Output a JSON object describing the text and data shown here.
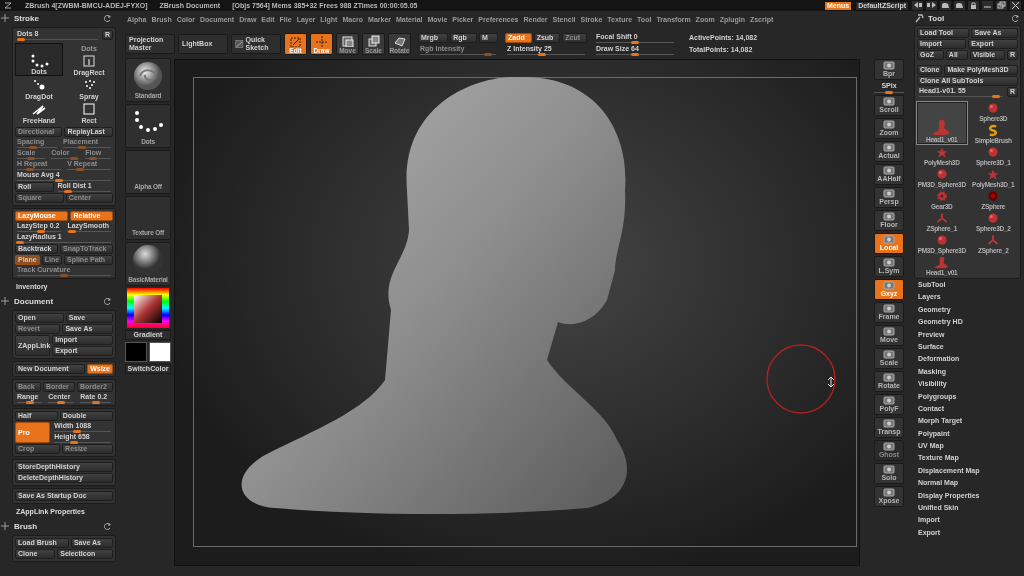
{
  "title_bar": {
    "app": "ZBrush 4[ZWBM-BMCU-ADEJ-FYXO]",
    "document": "ZBrush Document",
    "stats": "[Objs 7564] Mems 385+32 Frees 988 ZTimes 00:00:05.05",
    "menus": {
      "label": "Menus",
      "on": true
    },
    "script": "DefaultZScript"
  },
  "menu_bar": [
    "Alpha",
    "Brush",
    "Color",
    "Document",
    "Draw",
    "Edit",
    "File",
    "Layer",
    "Light",
    "Macro",
    "Marker",
    "Material",
    "Movie",
    "Picker",
    "Preferences",
    "Render",
    "Stencil",
    "Stroke",
    "Texture",
    "Tool",
    "Transform",
    "Zoom",
    "Zplugin",
    "Zscript"
  ],
  "toolbar": {
    "buttons": [
      {
        "kind": "button",
        "label": "Projection Master"
      },
      {
        "kind": "button",
        "label": "LightBox"
      },
      {
        "kind": "icon-button",
        "label": "Quick Sketch"
      }
    ],
    "modes": [
      {
        "label": "Edit",
        "on": true
      },
      {
        "label": "Draw",
        "on": true
      },
      {
        "label": "Move",
        "on": false
      },
      {
        "label": "Scale",
        "on": false
      },
      {
        "label": "Rotate",
        "on": false
      }
    ],
    "groups": [
      {
        "top": [
          {
            "kind": "button",
            "label": "Mrgb",
            "on": false,
            "disabled": false
          },
          {
            "kind": "button",
            "label": "Rgb",
            "on": false,
            "disabled": false
          },
          {
            "kind": "button",
            "label": "M",
            "on": false,
            "disabled": false
          }
        ],
        "bottom": [
          {
            "kind": "slider",
            "label": "Rgb Intensity",
            "level": 0.9,
            "disabled": true
          }
        ]
      },
      {
        "top": [
          {
            "kind": "button",
            "label": "Zadd",
            "on": true,
            "disabled": false
          },
          {
            "kind": "button",
            "label": "Zsub",
            "on": false,
            "disabled": false
          },
          {
            "kind": "button",
            "label": "Zcut",
            "on": false,
            "disabled": true
          }
        ],
        "bottom": [
          {
            "kind": "slider",
            "label": "Z Intensity 25",
            "level": 0.45,
            "disabled": false
          }
        ]
      },
      {
        "top": [
          {
            "kind": "slider",
            "label": "Focal Shift 0",
            "level": 0.5,
            "disabled": false
          }
        ],
        "bottom": [
          {
            "kind": "slider",
            "label": "Draw Size 64",
            "level": 0.5,
            "disabled": false
          }
        ]
      },
      {
        "top": [
          {
            "kind": "text",
            "label": "ActivePoints: 14,082"
          }
        ],
        "bottom": [
          {
            "kind": "text",
            "label": "TotalPoints: 14,082"
          }
        ]
      }
    ]
  },
  "left_panel": [
    {
      "kind": "header",
      "title": "Stroke"
    },
    {
      "kind": "box",
      "rows": [
        [
          {
            "kind": "slider",
            "label": "Dots 8",
            "level": 0.05,
            "disabled": false
          },
          {
            "kind": "small-button",
            "label": "R",
            "on": false,
            "disabled": false
          }
        ]
      ],
      "strokes": [
        {
          "label": "Dots",
          "selected": false
        },
        {
          "label": "Dots",
          "selected": true
        },
        {
          "label": "DragRect",
          "selected": false
        },
        {
          "label": "DragDot",
          "selected": false
        },
        {
          "label": "Spray",
          "selected": false
        },
        {
          "label": "FreeHand",
          "selected": false
        },
        {
          "label": "Rect",
          "selected": false
        }
      ],
      "rows2": [
        [
          {
            "kind": "button",
            "label": "Directional",
            "on": false,
            "disabled": true
          },
          {
            "kind": "button",
            "label": "ReplayLast",
            "on": false,
            "disabled": false
          }
        ],
        [
          {
            "kind": "slider",
            "label": "Spacing",
            "level": 0.4,
            "disabled": true
          },
          {
            "kind": "slider",
            "label": "Placement",
            "level": 0.4,
            "disabled": true
          }
        ],
        [
          {
            "kind": "slider",
            "label": "Scale",
            "level": 0.5,
            "disabled": true
          },
          {
            "kind": "slider",
            "label": "Color",
            "level": 0.8,
            "disabled": true
          },
          {
            "kind": "slider",
            "label": "Flow",
            "level": 0.3,
            "disabled": true
          }
        ],
        [
          {
            "kind": "slider",
            "label": "H Repeat",
            "level": 0.3,
            "disabled": true
          },
          {
            "kind": "slider",
            "label": "V Repeat",
            "level": 0.3,
            "disabled": true
          }
        ],
        [
          {
            "kind": "slider",
            "label": "Mouse Avg 4",
            "level": 0.45,
            "disabled": false
          }
        ],
        [
          {
            "kind": "button",
            "label": "Roll",
            "on": false,
            "disabled": false
          },
          {
            "kind": "slider",
            "label": "Roll Dist 1",
            "level": 0.2,
            "disabled": false
          }
        ],
        [
          {
            "kind": "button",
            "label": "Square",
            "on": false,
            "disabled": true
          },
          {
            "kind": "button",
            "label": "Center",
            "on": false,
            "disabled": true
          }
        ]
      ]
    },
    {
      "kind": "box",
      "rows": [
        [
          {
            "kind": "button",
            "label": "LazyMouse",
            "on": true,
            "disabled": false
          },
          {
            "kind": "button",
            "label": "Relative",
            "on": true,
            "disabled": false
          }
        ],
        [
          {
            "kind": "slider",
            "label": "LazyStep 0.2",
            "level": 0.55,
            "disabled": false
          },
          {
            "kind": "slider",
            "label": "LazySmooth",
            "level": 0.1,
            "disabled": false
          }
        ],
        [
          {
            "kind": "slider",
            "label": "LazyRadius 1",
            "level": 0.03,
            "disabled": false
          }
        ],
        [
          {
            "kind": "button",
            "label": "Backtrack",
            "on": false,
            "disabled": false
          },
          {
            "kind": "button",
            "label": "SnapToTrack",
            "on": false,
            "disabled": true
          }
        ],
        [
          {
            "kind": "pair",
            "items": [
              {
                "kind": "button",
                "label": "Plane",
                "on": true,
                "disabled": true
              },
              {
                "kind": "button",
                "label": "Line",
                "on": false,
                "disabled": true
              }
            ]
          },
          {
            "kind": "button",
            "label": "Spline Path",
            "on": false,
            "disabled": true
          }
        ],
        [
          {
            "kind": "slider",
            "label": "Track Curvature",
            "level": 0.5,
            "disabled": true
          }
        ]
      ]
    },
    {
      "kind": "link",
      "label": "Inventory"
    },
    {
      "kind": "header",
      "title": "Document"
    },
    {
      "kind": "box",
      "rows": [
        [
          {
            "kind": "button",
            "label": "Open",
            "on": false,
            "disabled": false
          },
          {
            "kind": "button",
            "label": "Save",
            "on": false,
            "disabled": false
          }
        ],
        [
          {
            "kind": "button",
            "label": "Revert",
            "on": false,
            "disabled": true
          },
          {
            "kind": "button",
            "label": "Save As",
            "on": false,
            "disabled": false
          }
        ],
        [
          {
            "kind": "tall-button",
            "label": "ZAppLink",
            "on": false,
            "disabled": false
          },
          {
            "kind": "stack",
            "items": [
              {
                "kind": "button",
                "label": "Import",
                "on": false,
                "disabled": false
              },
              {
                "kind": "button",
                "label": "Export",
                "on": false,
                "disabled": false
              }
            ]
          }
        ]
      ]
    },
    {
      "kind": "box",
      "rows": [
        [
          {
            "kind": "button",
            "label": "New Document",
            "on": false,
            "disabled": false
          },
          {
            "kind": "small-button",
            "label": "Wsize",
            "on": true,
            "disabled": false
          }
        ]
      ]
    },
    {
      "kind": "box",
      "rows": [
        [
          {
            "kind": "button",
            "label": "Back",
            "on": false,
            "disabled": true
          },
          {
            "kind": "button",
            "label": "Border",
            "on": false,
            "disabled": true
          },
          {
            "kind": "button",
            "label": "Border2",
            "on": false,
            "disabled": true
          }
        ],
        [
          {
            "kind": "slider",
            "label": "Range",
            "level": 0.5,
            "disabled": false
          },
          {
            "kind": "slider",
            "label": "Center",
            "level": 0.5,
            "disabled": false
          },
          {
            "kind": "slider",
            "label": "Rate 0.2",
            "level": 0.5,
            "disabled": false
          }
        ]
      ]
    },
    {
      "kind": "box",
      "rows": [
        [
          {
            "kind": "button",
            "label": "Half",
            "on": false,
            "disabled": false
          },
          {
            "kind": "button",
            "label": "Double",
            "on": false,
            "disabled": false
          }
        ],
        [
          {
            "kind": "tall-button",
            "label": "Pro",
            "on": true,
            "disabled": false
          },
          {
            "kind": "stack",
            "items": [
              {
                "kind": "slider",
                "label": "Width 1088",
                "level": 0.4,
                "disabled": false
              },
              {
                "kind": "slider",
                "label": "Height 658",
                "level": 0.35,
                "disabled": false
              }
            ]
          }
        ],
        [
          {
            "kind": "button",
            "label": "Crop",
            "on": false,
            "disabled": true
          },
          {
            "kind": "button",
            "label": "Resize",
            "on": false,
            "disabled": true
          }
        ]
      ]
    },
    {
      "kind": "box",
      "rows": [
        [
          {
            "kind": "button",
            "label": "StoreDepthHistory",
            "on": false,
            "disabled": false
          }
        ],
        [
          {
            "kind": "button",
            "label": "DeleteDepthHistory",
            "on": false,
            "disabled": false
          }
        ]
      ]
    },
    {
      "kind": "box",
      "rows": [
        [
          {
            "kind": "button",
            "label": "Save As Startup Doc",
            "on": false,
            "disabled": false
          }
        ]
      ]
    },
    {
      "kind": "link",
      "label": "ZAppLink Properties"
    },
    {
      "kind": "header",
      "title": "Brush"
    },
    {
      "kind": "box",
      "rows": [
        [
          {
            "kind": "button",
            "label": "Load Brush",
            "on": false,
            "disabled": false
          },
          {
            "kind": "button",
            "label": "Save As",
            "on": false,
            "disabled": false
          }
        ],
        [
          {
            "kind": "button",
            "label": "Clone",
            "on": false,
            "disabled": false
          },
          {
            "kind": "button",
            "label": "SelectIcon",
            "on": false,
            "disabled": false
          }
        ]
      ]
    }
  ],
  "left_shelf": {
    "thumbs": [
      {
        "kind": "brush",
        "label": "Standard"
      },
      {
        "kind": "stroke",
        "label": "Dots"
      },
      {
        "kind": "empty",
        "label": "Alpha Off"
      },
      {
        "kind": "empty",
        "label": "Texture Off"
      },
      {
        "kind": "material",
        "label": "BasicMaterial"
      }
    ],
    "gradient": "Gradient",
    "swatches": [
      {
        "color": "#000000"
      },
      {
        "color": "#ffffff"
      }
    ],
    "switch": "SwitchColor"
  },
  "right_shelf": [
    {
      "kind": "tool",
      "label": "Bpr",
      "on": false,
      "disabled": false
    },
    {
      "kind": "slider",
      "label": "SPix",
      "level": 0.5
    },
    {
      "kind": "tool",
      "label": "Scroll",
      "on": false,
      "disabled": false
    },
    {
      "kind": "tool",
      "label": "Zoom",
      "on": false,
      "disabled": false
    },
    {
      "kind": "tool",
      "label": "Actual",
      "on": false,
      "disabled": false
    },
    {
      "kind": "tool",
      "label": "AAHalf",
      "on": false,
      "disabled": false
    },
    {
      "kind": "tool",
      "label": "Persp",
      "on": false,
      "disabled": false
    },
    {
      "kind": "tool",
      "label": "Floor",
      "on": false,
      "disabled": false
    },
    {
      "kind": "tool",
      "label": "Local",
      "on": true,
      "disabled": false
    },
    {
      "kind": "tool",
      "label": "L.Sym",
      "on": false,
      "disabled": false
    },
    {
      "kind": "tool",
      "label": "Gxyz",
      "on": true,
      "disabled": false
    },
    {
      "kind": "tool",
      "label": "Frame",
      "on": false,
      "disabled": false
    },
    {
      "kind": "tool",
      "label": "Move",
      "on": false,
      "disabled": false
    },
    {
      "kind": "tool",
      "label": "Scale",
      "on": false,
      "disabled": false
    },
    {
      "kind": "tool",
      "label": "Rotate",
      "on": false,
      "disabled": false
    },
    {
      "kind": "tool",
      "label": "PolyF",
      "on": false,
      "disabled": false
    },
    {
      "kind": "tool",
      "label": "Transp",
      "on": false,
      "disabled": false
    },
    {
      "kind": "tool",
      "label": "Ghost",
      "on": false,
      "disabled": true
    },
    {
      "kind": "tool",
      "label": "Solo",
      "on": false,
      "disabled": false
    },
    {
      "kind": "tool",
      "label": "Xpose",
      "on": false,
      "disabled": false
    }
  ],
  "right_panel": {
    "title": "Tool",
    "rows": [
      [
        {
          "kind": "button",
          "label": "Load Tool",
          "on": false,
          "disabled": false
        },
        {
          "kind": "button",
          "label": "Save As",
          "on": false,
          "disabled": false
        }
      ],
      [
        {
          "kind": "button",
          "label": "Import",
          "on": false,
          "disabled": false
        },
        {
          "kind": "button",
          "label": "Export",
          "on": false,
          "disabled": false
        }
      ],
      [
        {
          "kind": "button",
          "label": "GoZ",
          "on": false,
          "disabled": false
        },
        {
          "kind": "button",
          "label": "All",
          "on": false,
          "disabled": false
        },
        {
          "kind": "button",
          "label": "Visible",
          "on": false,
          "disabled": false
        },
        {
          "kind": "small-button",
          "label": "R",
          "on": false,
          "disabled": false
        }
      ]
    ],
    "rows2": [
      [
        {
          "kind": "small-button",
          "label": "Clone",
          "on": false,
          "disabled": false
        },
        {
          "kind": "button",
          "label": "Make PolyMesh3D",
          "on": false,
          "disabled": false
        }
      ],
      [
        {
          "kind": "button",
          "label": "Clone All SubTools",
          "on": false,
          "disabled": false
        }
      ],
      [
        {
          "kind": "slider",
          "label": "Head1-v01. 55",
          "level": 0.92,
          "disabled": false
        },
        {
          "kind": "small-button",
          "label": "R",
          "on": false,
          "disabled": false
        }
      ]
    ],
    "tools": [
      {
        "kind": "sphere",
        "label": "Sphere3D",
        "selected": false
      },
      {
        "kind": "mesh",
        "label": "Head1_v01",
        "selected": true
      },
      {
        "kind": "brush",
        "label": "SimpleBrush",
        "selected": false
      },
      {
        "kind": "star",
        "label": "PolyMesh3D",
        "selected": false
      },
      {
        "kind": "sphere",
        "label": "Sphere3D_1",
        "selected": false
      },
      {
        "kind": "sphere",
        "label": "PM3D_Sphere3D",
        "selected": false
      },
      {
        "kind": "star",
        "label": "PolyMesh3D_1",
        "selected": false
      },
      {
        "kind": "gear",
        "label": "Gear3D",
        "selected": false
      },
      {
        "kind": "zsphere",
        "label": "ZSphere",
        "selected": false
      },
      {
        "kind": "tripod",
        "label": "ZSphere_1",
        "selected": false
      },
      {
        "kind": "sphere",
        "label": "Sphere3D_2",
        "selected": false
      },
      {
        "kind": "sphere",
        "label": "PM3D_Sphere3D",
        "selected": false
      },
      {
        "kind": "tripod",
        "label": "ZSphere_2",
        "selected": false
      },
      {
        "kind": "mesh",
        "label": "Head1_v01",
        "selected": false
      }
    ],
    "subpalettes": [
      "SubTool",
      "Layers",
      "Geometry",
      "Geometry HD",
      "Preview",
      "Surface",
      "Deformation",
      "Masking",
      "Visibility",
      "Polygroups",
      "Contact",
      "Morph Target",
      "Polypaint",
      "UV Map",
      "Texture Map",
      "Displacement Map",
      "Normal Map",
      "Display Properties",
      "Unified Skin",
      "Import",
      "Export"
    ]
  }
}
